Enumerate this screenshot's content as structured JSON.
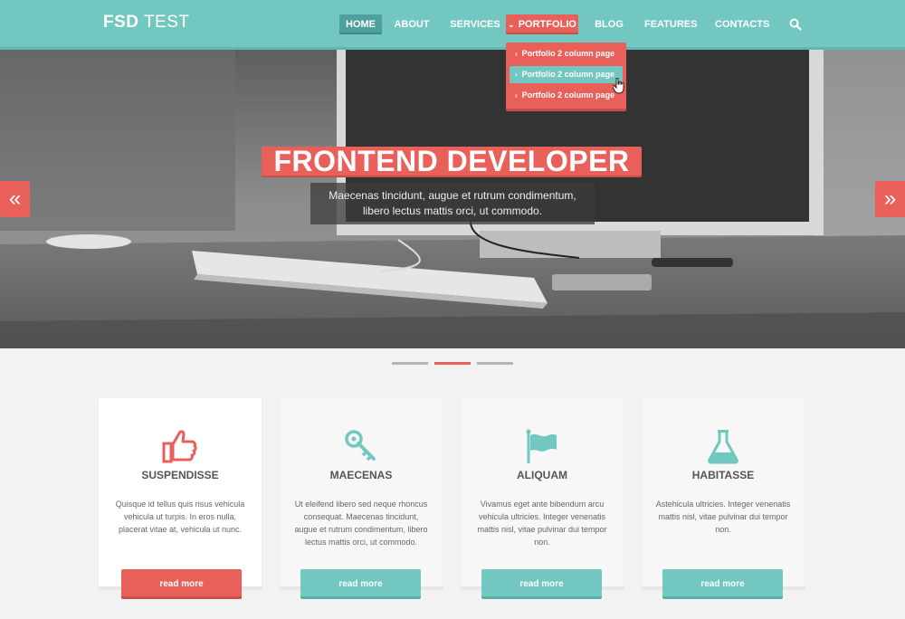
{
  "header": {
    "logo_bold": "FSD",
    "logo_regular": "TEST",
    "nav": [
      {
        "label": "HOME",
        "active": true
      },
      {
        "label": "ABOUT"
      },
      {
        "label": "SERVICES"
      },
      {
        "label": "PORTFOLIO",
        "open": true
      },
      {
        "label": "BLOG"
      },
      {
        "label": "FEATURES"
      },
      {
        "label": "CONTACTS"
      }
    ],
    "search_icon": "search-icon"
  },
  "dropdown": {
    "items": [
      {
        "label": "Portfolio 2 column page"
      },
      {
        "label": "Portfolio 2 column page",
        "hovered": true
      },
      {
        "label": "Portfolio 2 column page"
      }
    ]
  },
  "hero": {
    "title": "FRONTEND DEVELOPER",
    "subtitle_line1": "Maecenas tincidunt, augue et rutrum condimentum,",
    "subtitle_line2": "libero lectus mattis orci, ut commodo.",
    "prev_icon": "double-chevron-left-icon",
    "next_icon": "double-chevron-right-icon"
  },
  "slider": {
    "active_index": 2,
    "count": 3
  },
  "colors": {
    "accent_teal": "#72c7c1",
    "accent_red": "#e9605a",
    "bg": "#f2f2f2"
  },
  "cards": [
    {
      "icon": "thumbs-up-icon",
      "title": "SUSPENDISSE",
      "text": "Quisque id tellus quis risus vehicula vehicula ut turpis. In eros nulla, placerat vitae at, vehicula ut nunc.",
      "button": "read more"
    },
    {
      "icon": "key-icon",
      "title": "MAECENAS",
      "text": "Ut eleifend libero sed neque rhoncus consequat. Maecenas tincidunt, augue et rutrum condimentum, libero lectus mattis orci, ut commodo.",
      "button": "read more"
    },
    {
      "icon": "flag-icon",
      "title": "ALIQUAM",
      "text": "Vivamus eget ante bibendum arcu vehicula ultricies. Integer venenatis mattis nisl, vitae pulvinar dui tempor non.",
      "button": "read more"
    },
    {
      "icon": "flask-icon",
      "title": "HABITASSE",
      "text": "Astehicula ultricies. Integer venenatis mattis nisl, vitae pulvinar dui tempor non.",
      "button": "read more"
    }
  ]
}
